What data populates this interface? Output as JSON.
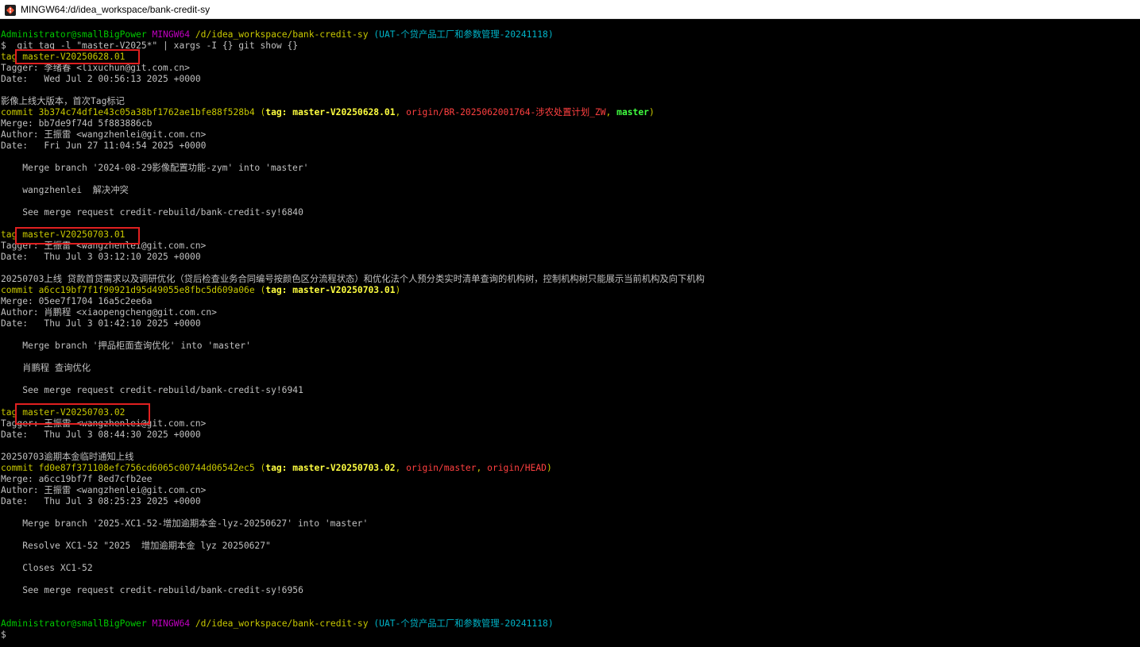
{
  "window": {
    "title": "MINGW64:/d/idea_workspace/bank-credit-sy",
    "app_icon": "git-bash-icon"
  },
  "colors": {
    "prompt_user": "#00c800",
    "prompt_shell": "#c000c0",
    "prompt_path": "#c8c800",
    "prompt_branch": "#00b4c8",
    "commit": "#c8c800",
    "remote_ref": "#ff4040",
    "tag_ref": "#ffff40",
    "local_branch": "#40ff40",
    "highlight": "#e02020"
  },
  "lines": [
    {
      "segments": [
        {
          "t": "Administrator@smallBigPower",
          "c": "green"
        },
        {
          "t": " ",
          "c": "white"
        },
        {
          "t": "MINGW64",
          "c": "magenta"
        },
        {
          "t": " ",
          "c": "white"
        },
        {
          "t": "/d/idea_workspace/bank-credit-sy",
          "c": "yellow"
        },
        {
          "t": " ",
          "c": "white"
        },
        {
          "t": "(UAT-个贷产品工厂和参数管理-20241118)",
          "c": "cyan"
        }
      ]
    },
    {
      "segments": [
        {
          "t": "$  git tag -l \"master-V2025*\" | xargs -I {} git show {}",
          "c": "white"
        }
      ]
    },
    {
      "segments": [
        {
          "t": "tag master-V20250628.01",
          "c": "yellow"
        }
      ]
    },
    {
      "segments": [
        {
          "t": "Tagger: 李绪春 <lixuchun@git.com.cn>",
          "c": "white"
        }
      ]
    },
    {
      "segments": [
        {
          "t": "Date:   Wed Jul 2 00:56:13 2025 +0000",
          "c": "white"
        }
      ]
    },
    {
      "segments": [
        {
          "t": "",
          "c": "white"
        }
      ]
    },
    {
      "segments": [
        {
          "t": "影像上线大版本，首次Tag标记",
          "c": "white"
        }
      ]
    },
    {
      "segments": [
        {
          "t": "commit 3b374c74df1e43c05a38bf1762ae1bfe88f528b4 (",
          "c": "yellow"
        },
        {
          "t": "tag: master-V20250628.01",
          "c": "byellow"
        },
        {
          "t": ", ",
          "c": "yellow"
        },
        {
          "t": "origin/BR-2025062001764-涉农处置计划_ZW",
          "c": "red"
        },
        {
          "t": ", ",
          "c": "yellow"
        },
        {
          "t": "master",
          "c": "bgreen"
        },
        {
          "t": ")",
          "c": "yellow"
        }
      ]
    },
    {
      "segments": [
        {
          "t": "Merge: bb7de9f74d 5f883886cb",
          "c": "white"
        }
      ]
    },
    {
      "segments": [
        {
          "t": "Author: 王振雷 <wangzhenlei@git.com.cn>",
          "c": "white"
        }
      ]
    },
    {
      "segments": [
        {
          "t": "Date:   Fri Jun 27 11:04:54 2025 +0000",
          "c": "white"
        }
      ]
    },
    {
      "segments": [
        {
          "t": "",
          "c": "white"
        }
      ]
    },
    {
      "segments": [
        {
          "t": "    Merge branch '2024-08-29影像配置功能-zym' into 'master'",
          "c": "white"
        }
      ]
    },
    {
      "segments": [
        {
          "t": "",
          "c": "white"
        }
      ]
    },
    {
      "segments": [
        {
          "t": "    wangzhenlei  解决冲突",
          "c": "white"
        }
      ]
    },
    {
      "segments": [
        {
          "t": "",
          "c": "white"
        }
      ]
    },
    {
      "segments": [
        {
          "t": "    See merge request credit-rebuild/bank-credit-sy!6840",
          "c": "white"
        }
      ]
    },
    {
      "segments": [
        {
          "t": "",
          "c": "white"
        }
      ]
    },
    {
      "segments": [
        {
          "t": "tag master-V20250703.01",
          "c": "yellow"
        }
      ]
    },
    {
      "segments": [
        {
          "t": "Tagger: 王振雷 <wangzhenlei@git.com.cn>",
          "c": "white"
        }
      ]
    },
    {
      "segments": [
        {
          "t": "Date:   Thu Jul 3 03:12:10 2025 +0000",
          "c": "white"
        }
      ]
    },
    {
      "segments": [
        {
          "t": "",
          "c": "white"
        }
      ]
    },
    {
      "segments": [
        {
          "t": "20250703上线 贷款首贷需求以及调研优化（贷后检查业务合同编号按颜色区分流程状态）和优化法个人预分类实时清单查询的机构树，控制机构树只能展示当前机构及向下机构",
          "c": "white"
        }
      ]
    },
    {
      "segments": [
        {
          "t": "commit a6cc19bf7f1f90921d95d49055e8fbc5d609a06e (",
          "c": "yellow"
        },
        {
          "t": "tag: master-V20250703.01",
          "c": "byellow"
        },
        {
          "t": ")",
          "c": "yellow"
        }
      ]
    },
    {
      "segments": [
        {
          "t": "Merge: 05ee7f1704 16a5c2ee6a",
          "c": "white"
        }
      ]
    },
    {
      "segments": [
        {
          "t": "Author: 肖鹏程 <xiaopengcheng@git.com.cn>",
          "c": "white"
        }
      ]
    },
    {
      "segments": [
        {
          "t": "Date:   Thu Jul 3 01:42:10 2025 +0000",
          "c": "white"
        }
      ]
    },
    {
      "segments": [
        {
          "t": "",
          "c": "white"
        }
      ]
    },
    {
      "segments": [
        {
          "t": "    Merge branch '押品柜面查询优化' into 'master'",
          "c": "white"
        }
      ]
    },
    {
      "segments": [
        {
          "t": "",
          "c": "white"
        }
      ]
    },
    {
      "segments": [
        {
          "t": "    肖鹏程 查询优化",
          "c": "white"
        }
      ]
    },
    {
      "segments": [
        {
          "t": "",
          "c": "white"
        }
      ]
    },
    {
      "segments": [
        {
          "t": "    See merge request credit-rebuild/bank-credit-sy!6941",
          "c": "white"
        }
      ]
    },
    {
      "segments": [
        {
          "t": "",
          "c": "white"
        }
      ]
    },
    {
      "segments": [
        {
          "t": "tag master-V20250703.02",
          "c": "yellow"
        }
      ]
    },
    {
      "segments": [
        {
          "t": "Tagger: 王振雷 <wangzhenlei@git.com.cn>",
          "c": "white"
        }
      ]
    },
    {
      "segments": [
        {
          "t": "Date:   Thu Jul 3 08:44:30 2025 +0000",
          "c": "white"
        }
      ]
    },
    {
      "segments": [
        {
          "t": "",
          "c": "white"
        }
      ]
    },
    {
      "segments": [
        {
          "t": "20250703逾期本金临时通知上线",
          "c": "white"
        }
      ]
    },
    {
      "segments": [
        {
          "t": "commit fd0e87f371108efc756cd6065c00744d06542ec5 (",
          "c": "yellow"
        },
        {
          "t": "tag: master-V20250703.02",
          "c": "byellow"
        },
        {
          "t": ", ",
          "c": "yellow"
        },
        {
          "t": "origin/master",
          "c": "red"
        },
        {
          "t": ", ",
          "c": "yellow"
        },
        {
          "t": "origin/HEAD",
          "c": "red"
        },
        {
          "t": ")",
          "c": "yellow"
        }
      ]
    },
    {
      "segments": [
        {
          "t": "Merge: a6cc19bf7f 8ed7cfb2ee",
          "c": "white"
        }
      ]
    },
    {
      "segments": [
        {
          "t": "Author: 王振雷 <wangzhenlei@git.com.cn>",
          "c": "white"
        }
      ]
    },
    {
      "segments": [
        {
          "t": "Date:   Thu Jul 3 08:25:23 2025 +0000",
          "c": "white"
        }
      ]
    },
    {
      "segments": [
        {
          "t": "",
          "c": "white"
        }
      ]
    },
    {
      "segments": [
        {
          "t": "    Merge branch '2025-XC1-52-增加逾期本金-lyz-20250627' into 'master'",
          "c": "white"
        }
      ]
    },
    {
      "segments": [
        {
          "t": "",
          "c": "white"
        }
      ]
    },
    {
      "segments": [
        {
          "t": "    Resolve XC1-52 \"2025  增加逾期本金 lyz 20250627\"",
          "c": "white"
        }
      ]
    },
    {
      "segments": [
        {
          "t": "",
          "c": "white"
        }
      ]
    },
    {
      "segments": [
        {
          "t": "    Closes XC1-52",
          "c": "white"
        }
      ]
    },
    {
      "segments": [
        {
          "t": "",
          "c": "white"
        }
      ]
    },
    {
      "segments": [
        {
          "t": "    See merge request credit-rebuild/bank-credit-sy!6956",
          "c": "white"
        }
      ]
    },
    {
      "segments": [
        {
          "t": "",
          "c": "white"
        }
      ]
    },
    {
      "segments": [
        {
          "t": "",
          "c": "white"
        }
      ]
    },
    {
      "segments": [
        {
          "t": "Administrator@smallBigPower",
          "c": "green"
        },
        {
          "t": " ",
          "c": "white"
        },
        {
          "t": "MINGW64",
          "c": "magenta"
        },
        {
          "t": " ",
          "c": "white"
        },
        {
          "t": "/d/idea_workspace/bank-credit-sy",
          "c": "yellow"
        },
        {
          "t": " ",
          "c": "white"
        },
        {
          "t": "(UAT-个贷产品工厂和参数管理-20241118)",
          "c": "cyan"
        }
      ]
    },
    {
      "segments": [
        {
          "t": "$",
          "c": "white"
        }
      ]
    }
  ]
}
